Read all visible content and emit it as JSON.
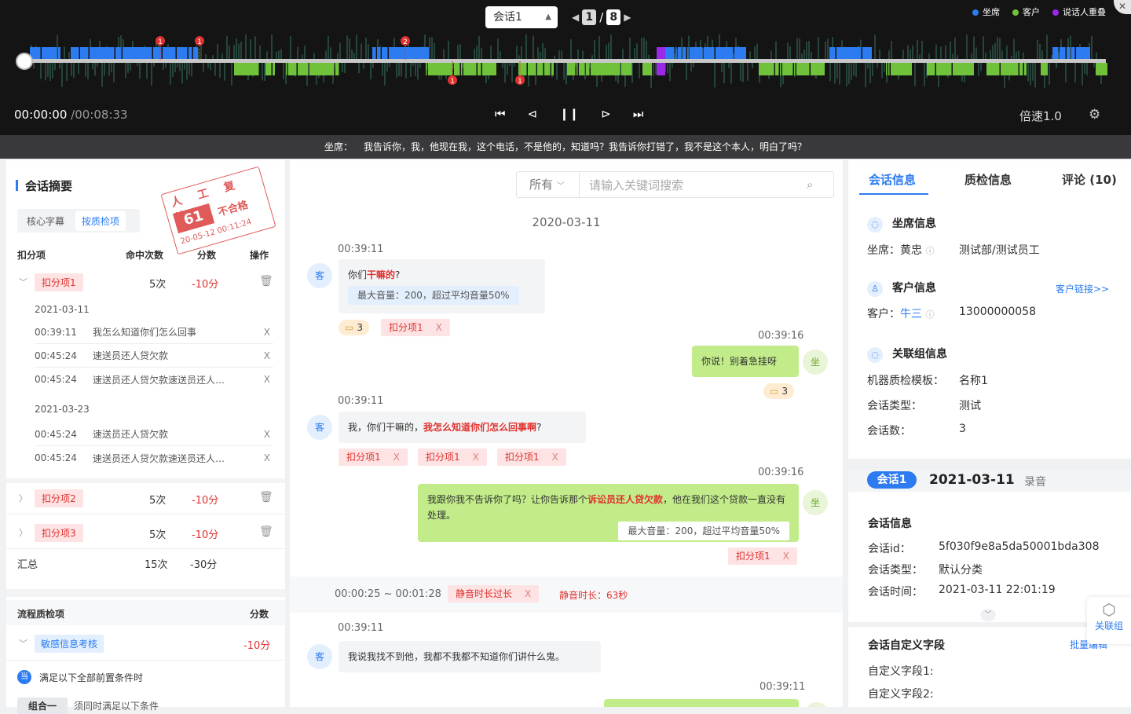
{
  "player": {
    "session_select": "会话1",
    "page_current": "1",
    "page_sep": "/",
    "page_total": "8",
    "legend": [
      {
        "label": "坐席",
        "color": "#2c7bf0"
      },
      {
        "label": "客户",
        "color": "#6fc23a"
      },
      {
        "label": "说话人重叠",
        "color": "#9b27e8"
      }
    ],
    "markers": [
      "1",
      "1",
      "2",
      "1",
      "1"
    ],
    "time_current": "00:00:00",
    "time_total": "/00:08:33",
    "speed": "倍速1.0",
    "progress": 0.0
  },
  "subtitle": {
    "speaker": "坐席：",
    "text": "我告诉你，我，他现在我，这个电话，不是他的，知道吗？我告诉你打错了，我不是这个本人，明白了吗？"
  },
  "left": {
    "title": "会话摘要",
    "tabs": [
      "核心字幕",
      "按质检项"
    ],
    "stamp": {
      "title": "人 工 复 检",
      "score": "61",
      "result": "不合格",
      "date": "20-05-12 00:11:24"
    },
    "headers": {
      "item": "扣分项",
      "hits": "命中次数",
      "score": "分数",
      "op": "操作"
    },
    "items": [
      {
        "name": "扣分项1",
        "hits": "5次",
        "score": "-10分",
        "groups": [
          {
            "date": "2021-03-11",
            "rows": [
              {
                "time": "00:39:11",
                "text": "我怎么知道你们怎么回事"
              },
              {
                "time": "00:45:24",
                "text": "速送员还人贷欠款"
              },
              {
                "time": "00:45:24",
                "text": "速送员还人贷欠款速送员还人…"
              }
            ]
          },
          {
            "date": "2021-03-23",
            "rows": [
              {
                "time": "00:45:24",
                "text": "速送员还人贷欠款"
              },
              {
                "time": "00:45:24",
                "text": "速送员还人贷欠款速送员还人…"
              }
            ]
          }
        ]
      },
      {
        "name": "扣分项2",
        "hits": "5次",
        "score": "-10分"
      },
      {
        "name": "扣分项3",
        "hits": "5次",
        "score": "-10分"
      }
    ],
    "row_remove": "X",
    "summary": {
      "label": "汇总",
      "hits": "15次",
      "score": "-30分"
    },
    "flow": {
      "header": "流程质检项",
      "score_header": "分数",
      "item": "敏感信息考核",
      "item_score": "-10分",
      "cond_icon": "当",
      "cond_text": "满足以下全部前置条件时",
      "group_label": "组合一",
      "group_text": "须同时满足以下条件"
    }
  },
  "mid": {
    "filter": "所有",
    "search_placeholder": "请输入关键词搜索",
    "date": "2020-03-11",
    "avatar_customer": "客",
    "avatar_agent": "坐",
    "messages": {
      "m1_time": "00:39:11",
      "m1_pre": "你们",
      "m1_hl": "干嘛的",
      "m1_post": "?",
      "m1_vol": "最大音量：200，超过平均音量50%",
      "m1_cmt": "3",
      "m1_tag": "扣分项1",
      "m2_time": "00:39:16",
      "m2_text": "你说！别着急挂呀",
      "m2_cmt": "3",
      "m3_time": "00:39:11",
      "m3_pre": "我，你们干嘛的，",
      "m3_hl": "我怎么知道你们怎么回事啊",
      "m3_post": "?",
      "m3_tags": [
        "扣分项1",
        "扣分项1",
        "扣分项1"
      ],
      "m4_time": "00:39:16",
      "m4_pre": "我跟你我不告诉你了吗？让你告诉那个",
      "m4_hl": "诉讼员还人贷欠款",
      "m4_post": "，他在我们这个贷款一直没有处理。",
      "m4_vol": "最大音量：200，超过平均音量50%",
      "m4_tag": "扣分项1",
      "silence_range": "00:00:25 ~ 00:01:28",
      "silence_tag": "静音时长过长",
      "silence_len": "静音时长：63秒",
      "m5_time": "00:39:11",
      "m5_text": "我说我找不到他，我都不我都不知道你们讲什么鬼。",
      "m6_time": "00:39:11"
    },
    "tag_remove": "X"
  },
  "right": {
    "tabs": [
      "会话信息",
      "质检信息",
      "评论 (10)"
    ],
    "agent_section": "坐席信息",
    "agent_label": "坐席：",
    "agent_name": "黄忠",
    "agent_dept": "测试部/测试员工",
    "cust_section": "客户信息",
    "cust_link": "客户链接>>",
    "cust_label": "客户：",
    "cust_name": "牛三",
    "cust_phone": "13000000058",
    "group_section": "关联组信息",
    "tpl_label": "机器质检模板：",
    "tpl_val": "名称1",
    "type_label": "会话类型：",
    "type_val": "测试",
    "count_label": "会话数：",
    "count_val": "3",
    "sess_pill": "会话1",
    "sess_date": "2021-03-11",
    "sess_kind": "录音",
    "info_section": "会话信息",
    "id_label": "会话id：",
    "id_val": "5f030f9e8a5da50001bda308",
    "stype_label": "会话类型：",
    "stype_val": "默认分类",
    "stime_label": "会话时间：",
    "stime_val": "2021-03-11  22:01:19",
    "custom_section": "会话自定义字段",
    "custom_link": "批量编辑",
    "field1": "自定义字段1:",
    "field2": "自定义字段2:",
    "float_label": "关联组"
  }
}
